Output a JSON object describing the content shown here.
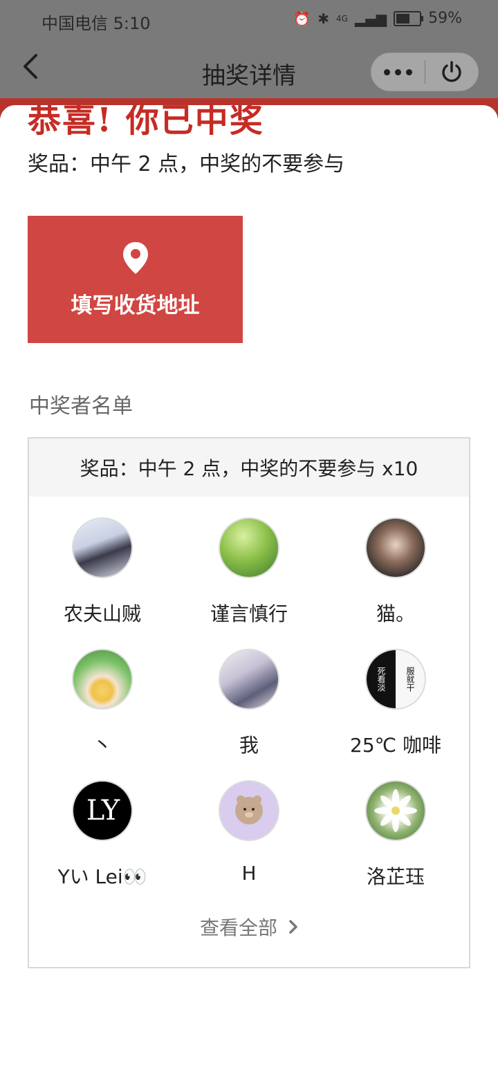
{
  "status_bar": {
    "carrier_time": "中国电信 5:10",
    "network": "4G",
    "battery_percent": "59%",
    "battery_level": 0.59
  },
  "nav": {
    "title": "抽奖详情",
    "back_icon": "chevron-left-icon",
    "more_icon": "more-dots-icon",
    "power_icon": "power-icon"
  },
  "header": {
    "congrats_text": "恭喜! 你已中奖"
  },
  "prize": {
    "line": "奖品：中午 2 点，中奖的不要参与"
  },
  "address_button": {
    "label": "填写收货地址",
    "icon": "location-pin-icon"
  },
  "winners": {
    "heading": "中奖者名单",
    "card_header": "奖品：中午 2 点，中奖的不要参与 x10",
    "list": [
      {
        "name": "农夫山贼"
      },
      {
        "name": "谨言慎行"
      },
      {
        "name": "猫。"
      },
      {
        "name": "丶"
      },
      {
        "name": "我"
      },
      {
        "name": "25℃ 咖啡"
      },
      {
        "name": "Yい Lei👀",
        "avatar_text": "LY"
      },
      {
        "name": "H"
      },
      {
        "name": "洛芷珏"
      }
    ],
    "avatar6_left": "死看淡",
    "avatar6_right": "服就干",
    "view_all": "查看全部"
  },
  "colors": {
    "accent_red": "#d04642",
    "congrats_red": "#c62b24"
  }
}
